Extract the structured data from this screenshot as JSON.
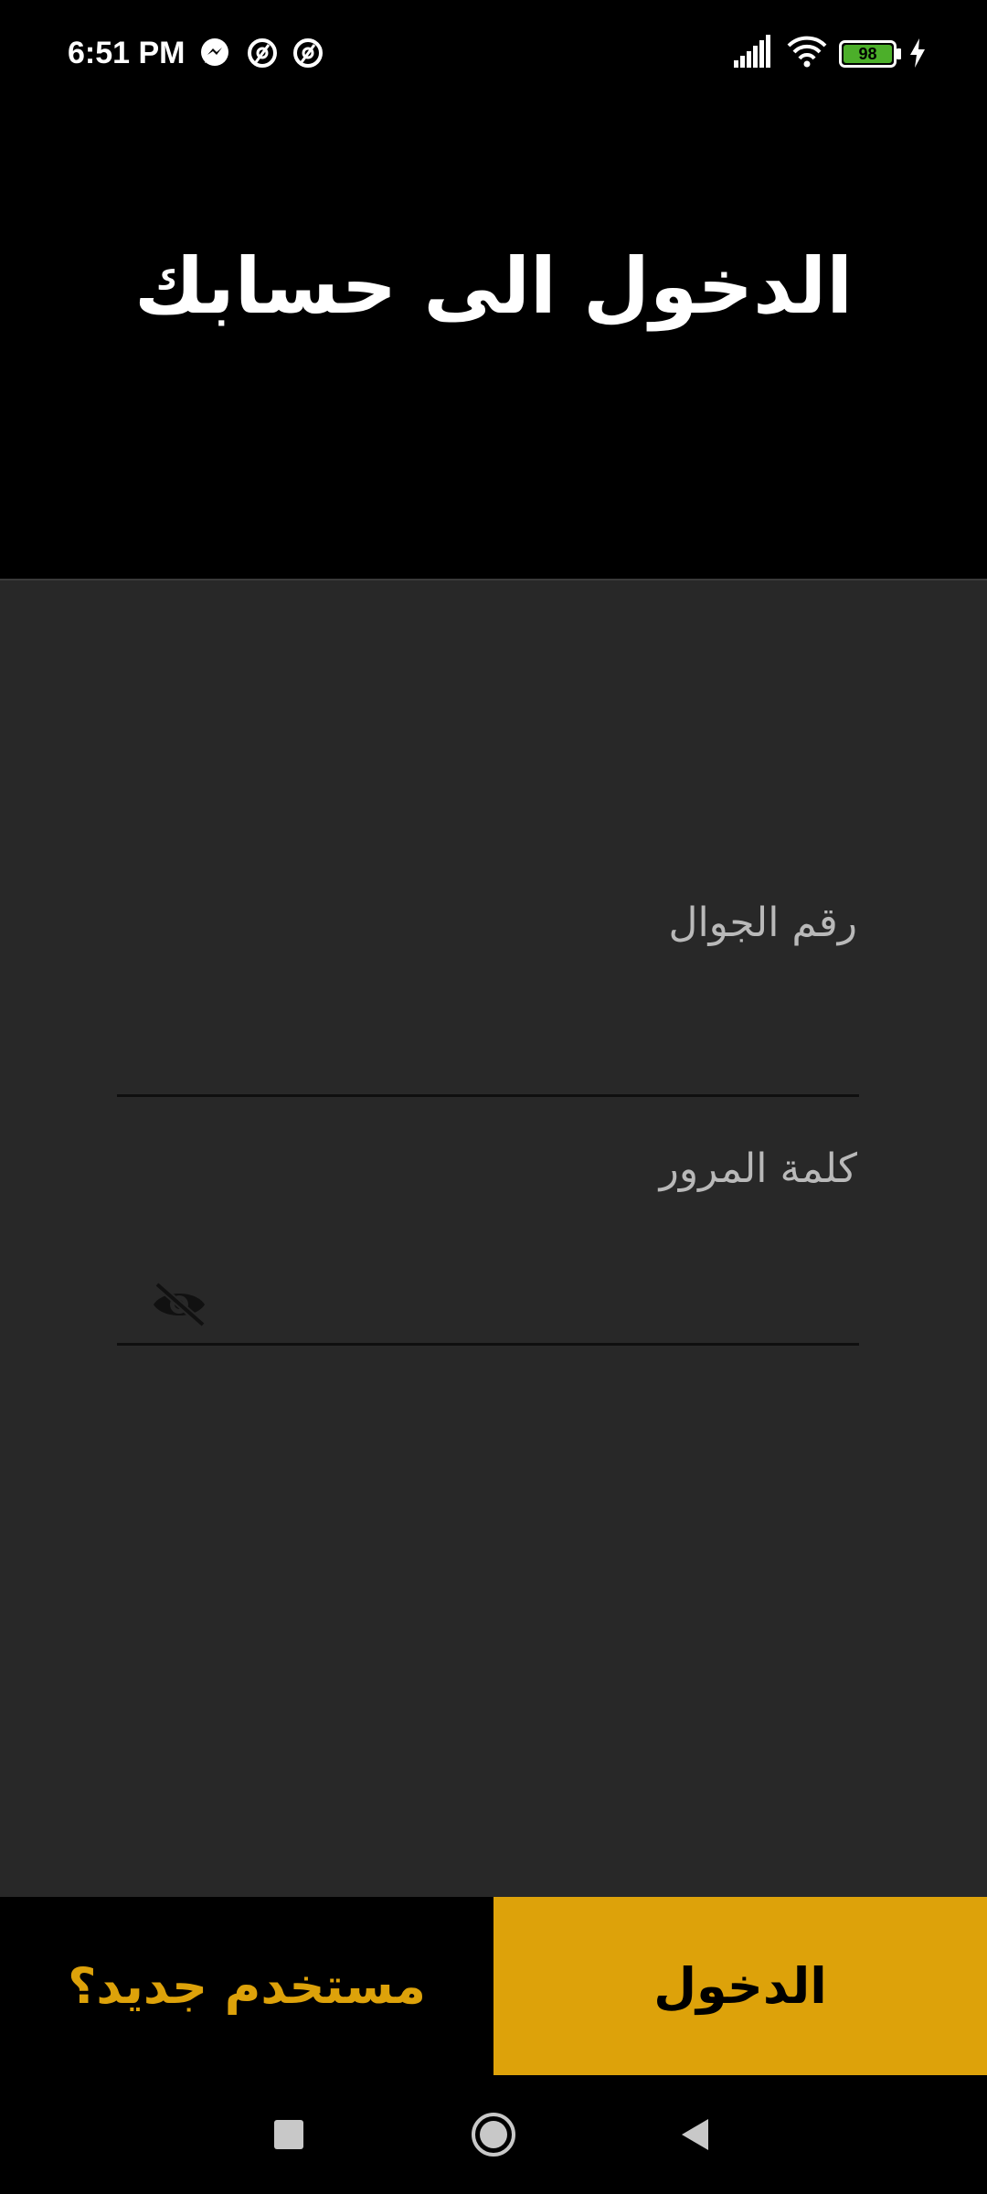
{
  "status_bar": {
    "time": "6:51 PM",
    "notification_icons": [
      "messenger-icon",
      "app-notification-icon",
      "app-notification-icon"
    ],
    "battery_level": "98",
    "battery_color": "#4caf2a",
    "charging": true
  },
  "header": {
    "title": "الدخول الى حسابك"
  },
  "form": {
    "phone_label": "رقم الجوال",
    "phone_value": "",
    "password_label": "كلمة المرور",
    "password_value": "",
    "password_visibility_icon": "eye-off-icon"
  },
  "actions": {
    "new_user_label": "مستخدم جديد؟",
    "login_label": "الدخول",
    "accent_color": "#dda20a"
  },
  "navigation": {
    "buttons": [
      "recents-square-icon",
      "home-circle-icon",
      "back-triangle-icon"
    ]
  }
}
